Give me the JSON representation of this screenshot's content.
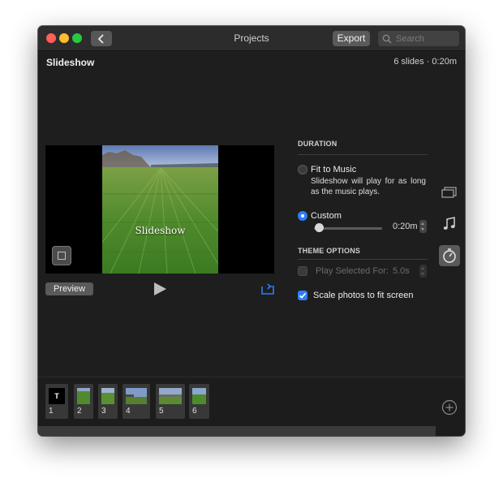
{
  "window": {
    "title": "Projects"
  },
  "toolbar": {
    "export_label": "Export",
    "search_placeholder": "Search"
  },
  "project": {
    "name": "Slideshow",
    "info": "6 slides · 0:20m"
  },
  "viewer": {
    "overlay_text": "Slideshow",
    "preview_label": "Preview"
  },
  "duration": {
    "heading": "DURATION",
    "fit_label": "Fit to Music",
    "fit_description": "Slideshow will play for as long as the music plays.",
    "custom_label": "Custom",
    "custom_value": "0:20m",
    "custom_selected": true
  },
  "theme": {
    "heading": "THEME OPTIONS",
    "play_selected_label": "Play Selected For:",
    "play_selected_value": "5.0s",
    "scale_label": "Scale photos to fit screen",
    "scale_checked": true
  },
  "filmstrip": {
    "items": [
      {
        "number": "1",
        "kind": "title",
        "glyph": "T"
      },
      {
        "number": "2",
        "kind": "photo"
      },
      {
        "number": "3",
        "kind": "photo"
      },
      {
        "number": "4",
        "kind": "photo"
      },
      {
        "number": "5",
        "kind": "photo"
      },
      {
        "number": "6",
        "kind": "photo"
      }
    ]
  },
  "colors": {
    "accent": "#2f7cf6",
    "window_bg": "#1e1e1e",
    "titlebar": "#2c2c2c"
  }
}
